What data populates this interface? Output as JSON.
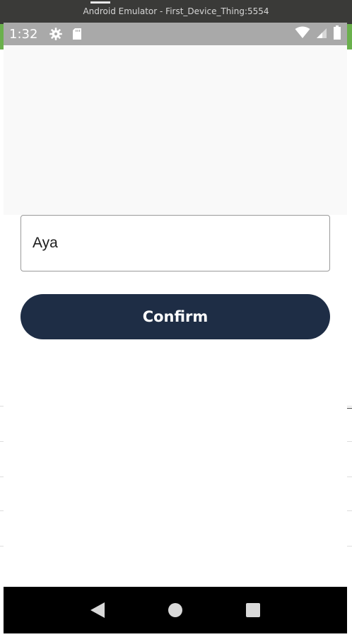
{
  "window": {
    "title": "Android Emulator - First_Device_Thing:5554"
  },
  "status_bar": {
    "time": "1:32",
    "icons": [
      "settings-gear-icon",
      "sd-card-icon",
      "wifi-icon",
      "cellular-signal-icon",
      "battery-icon"
    ]
  },
  "form": {
    "name_value": "Aya",
    "confirm_label": "Confirm"
  },
  "nav_bar": {
    "icons": [
      "back-icon",
      "home-icon",
      "recents-icon"
    ]
  },
  "colors": {
    "button_bg": "#1e2d45",
    "status_bar_bg": "#a9a9a9",
    "nav_bar_bg": "#000000"
  }
}
